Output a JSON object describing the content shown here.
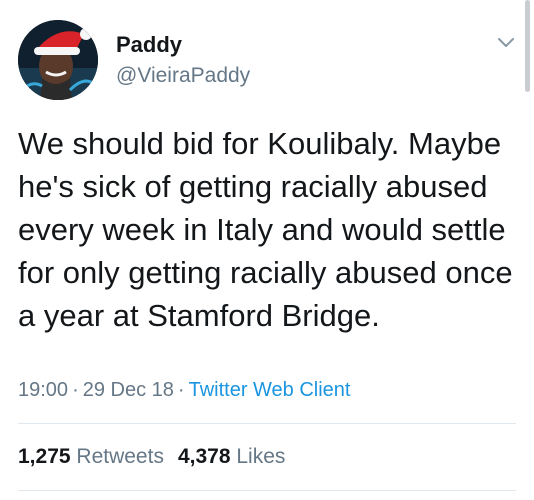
{
  "tweet": {
    "author": {
      "display_name": "Paddy",
      "handle": "@VieiraPaddy",
      "avatar_icon": "avatar-santa-hat"
    },
    "text": "We should bid for Koulibaly. Maybe he's sick of getting racially abused every week in Italy and would settle for only getting racially abused once a year at Stamford Bridge.",
    "time": "19:00",
    "date": "29 Dec 18",
    "separator": "·",
    "client": "Twitter Web Client",
    "stats": {
      "retweets_count": "1,275",
      "retweets_label": "Retweets",
      "likes_count": "4,378",
      "likes_label": "Likes"
    }
  },
  "icons": {
    "menu": "chevron-down-icon"
  },
  "colors": {
    "text": "#14171a",
    "secondary": "#657786",
    "link": "#1b95e0",
    "divider": "#e1e8ed"
  }
}
